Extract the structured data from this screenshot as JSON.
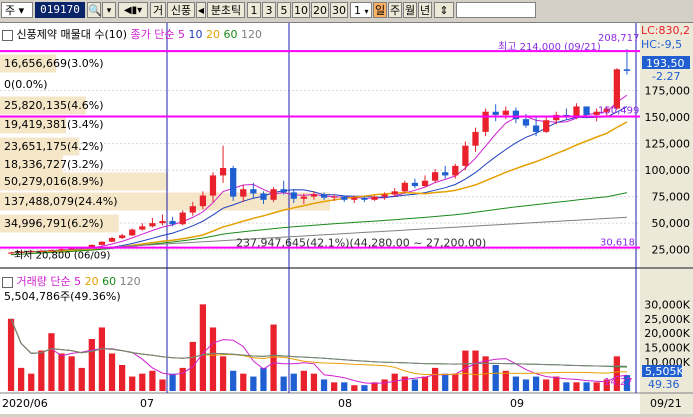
{
  "toolbar": {
    "type_label": "주",
    "stock_code": "019170",
    "search_icon": "search-icon",
    "unit_label": "거",
    "company_label": "신풍",
    "prev_label": "◀",
    "tick_label": "분초틱",
    "periods": [
      "1",
      "3",
      "5",
      "10",
      "20",
      "30"
    ],
    "period_value": "1",
    "day_label": "일",
    "week_label": "주",
    "month_label": "월",
    "year_label": "년",
    "updown_icon": "updown-arrows-icon"
  },
  "price_panel": {
    "title": "신풍제약 매물대 수(10)",
    "ma_title": "종가 단순",
    "ma_periods": [
      "5",
      "10",
      "20",
      "60",
      "120"
    ],
    "lc_label": "LC:830,2",
    "hc_label": "HC:-9,5",
    "current_price": "193,50",
    "pct_change": "-2.27",
    "ma5_marker": "208,717",
    "ma_marker2": "150,499",
    "low_marker": "30,618",
    "high_annotation": "최고 214,000 (09/21)",
    "low_annotation": "최저 20,800 (06/09)",
    "range_annotation": "237,947,645(42.1%)(44,280.00 ~ 27,200.00)",
    "volume_profile": [
      "16,656,669(3.0%)",
      "0(0.0%)",
      "25,820,135(4.6%)",
      "19,419,381(3.4%)",
      "23,651,175(4.2%)",
      "18,336,727(3.2%)",
      "50,279,016(8.9%)",
      "137,488,079(24.4%)",
      "34,996,791(6.2%)"
    ],
    "y_ticks": [
      "175,000",
      "150,000",
      "125,000",
      "100,000",
      "75,000",
      "50,000",
      "25,000"
    ]
  },
  "volume_panel": {
    "title": "거래량 단순",
    "ma_periods": [
      "5",
      "20",
      "60",
      "120"
    ],
    "summary": "5,504,786주(49.36%)",
    "current_volume": "5,505K",
    "pct": "49.36",
    "marker": "14,27",
    "y_ticks": [
      "30,000K",
      "25,000K",
      "20,000K",
      "15,000K",
      "10,000K"
    ]
  },
  "x_axis": [
    "2020/06",
    "07",
    "08",
    "09",
    "09/21"
  ],
  "colors": {
    "up": "#e8212d",
    "down": "#1f5fd1",
    "ma5": "#d020d0",
    "ma10": "#1f3fc0",
    "ma20": "#e5a000",
    "ma60": "#1a8a1a",
    "ma120": "#808080",
    "line": "#ff00ff",
    "vp": "#f5e6c8"
  },
  "chart_data": {
    "type": "candlestick",
    "candles": [
      [
        21.5,
        22.8,
        20.8,
        22.3
      ],
      [
        22.3,
        23.5,
        21.9,
        23.0
      ],
      [
        23,
        24,
        22.5,
        23.8
      ],
      [
        23.8,
        24.5,
        23,
        24
      ],
      [
        24,
        25,
        23.5,
        24.5
      ],
      [
        24.5,
        26,
        24,
        25.5
      ],
      [
        25.5,
        27,
        25,
        26.5
      ],
      [
        26.5,
        28,
        26,
        27.5
      ],
      [
        27.5,
        30,
        27,
        29.5
      ],
      [
        29.5,
        33,
        29,
        32.5
      ],
      [
        32.5,
        37,
        32,
        36
      ],
      [
        36,
        40,
        35,
        38.5
      ],
      [
        38.5,
        45,
        38,
        44
      ],
      [
        44,
        50,
        43,
        47
      ],
      [
        47,
        55,
        46,
        50
      ],
      [
        50,
        58,
        48,
        52
      ],
      [
        52,
        56,
        47,
        49
      ],
      [
        49,
        62,
        48,
        60
      ],
      [
        60,
        70,
        57,
        66
      ],
      [
        66,
        80,
        63,
        76
      ],
      [
        76,
        98,
        70,
        95
      ],
      [
        95,
        123,
        88,
        102
      ],
      [
        102,
        104,
        71,
        75
      ],
      [
        75,
        86,
        70,
        82
      ],
      [
        82,
        88,
        74,
        78
      ],
      [
        78,
        80,
        68,
        72
      ],
      [
        72,
        84,
        70,
        82
      ],
      [
        82,
        90,
        77,
        79
      ],
      [
        79,
        82,
        69,
        73
      ],
      [
        73,
        78,
        68,
        75
      ],
      [
        75,
        80,
        72,
        77
      ],
      [
        77,
        79,
        72,
        74
      ],
      [
        74,
        77,
        71,
        75
      ],
      [
        75,
        76,
        70,
        72
      ],
      [
        72,
        76,
        69,
        74
      ],
      [
        74,
        75,
        70,
        72
      ],
      [
        72,
        76,
        71,
        75
      ],
      [
        75,
        79,
        72,
        77
      ],
      [
        77,
        83,
        75,
        80
      ],
      [
        80,
        90,
        78,
        88
      ],
      [
        88,
        92,
        83,
        85
      ],
      [
        85,
        95,
        84,
        90
      ],
      [
        90,
        101,
        88,
        98
      ],
      [
        98,
        104,
        92,
        95
      ],
      [
        95,
        106,
        92,
        104
      ],
      [
        104,
        127,
        100,
        123
      ],
      [
        123,
        140,
        117,
        136
      ],
      [
        136,
        158,
        132,
        155
      ],
      [
        155,
        162,
        146,
        152
      ],
      [
        152,
        160,
        148,
        156
      ],
      [
        156,
        159,
        144,
        148
      ],
      [
        148,
        153,
        140,
        142
      ],
      [
        142,
        150,
        132,
        136
      ],
      [
        136,
        150,
        135,
        147
      ],
      [
        147,
        155,
        143,
        152
      ],
      [
        152,
        158,
        148,
        150
      ],
      [
        150,
        163,
        148,
        160
      ],
      [
        160,
        158,
        150,
        152
      ],
      [
        152,
        158,
        146,
        155
      ],
      [
        155,
        160,
        150,
        158
      ],
      [
        158,
        196,
        157,
        195
      ],
      [
        195,
        214,
        190,
        193.5
      ]
    ],
    "volumes": [
      25,
      8,
      6,
      14,
      20,
      13,
      12,
      8,
      18,
      22,
      13,
      9,
      5,
      6,
      7,
      4,
      6,
      8,
      17,
      30,
      22,
      12,
      7,
      6,
      5,
      8,
      23,
      5,
      6,
      7,
      6,
      4,
      3,
      3,
      2,
      2,
      3,
      4,
      6,
      5,
      4,
      5,
      8,
      6,
      6,
      14,
      14,
      12,
      9,
      7,
      5,
      4,
      5,
      4,
      5,
      3,
      3,
      3,
      3,
      4,
      12,
      5.5
    ],
    "ylim": [
      20,
      216
    ],
    "vol_ylim": [
      0,
      36
    ]
  }
}
